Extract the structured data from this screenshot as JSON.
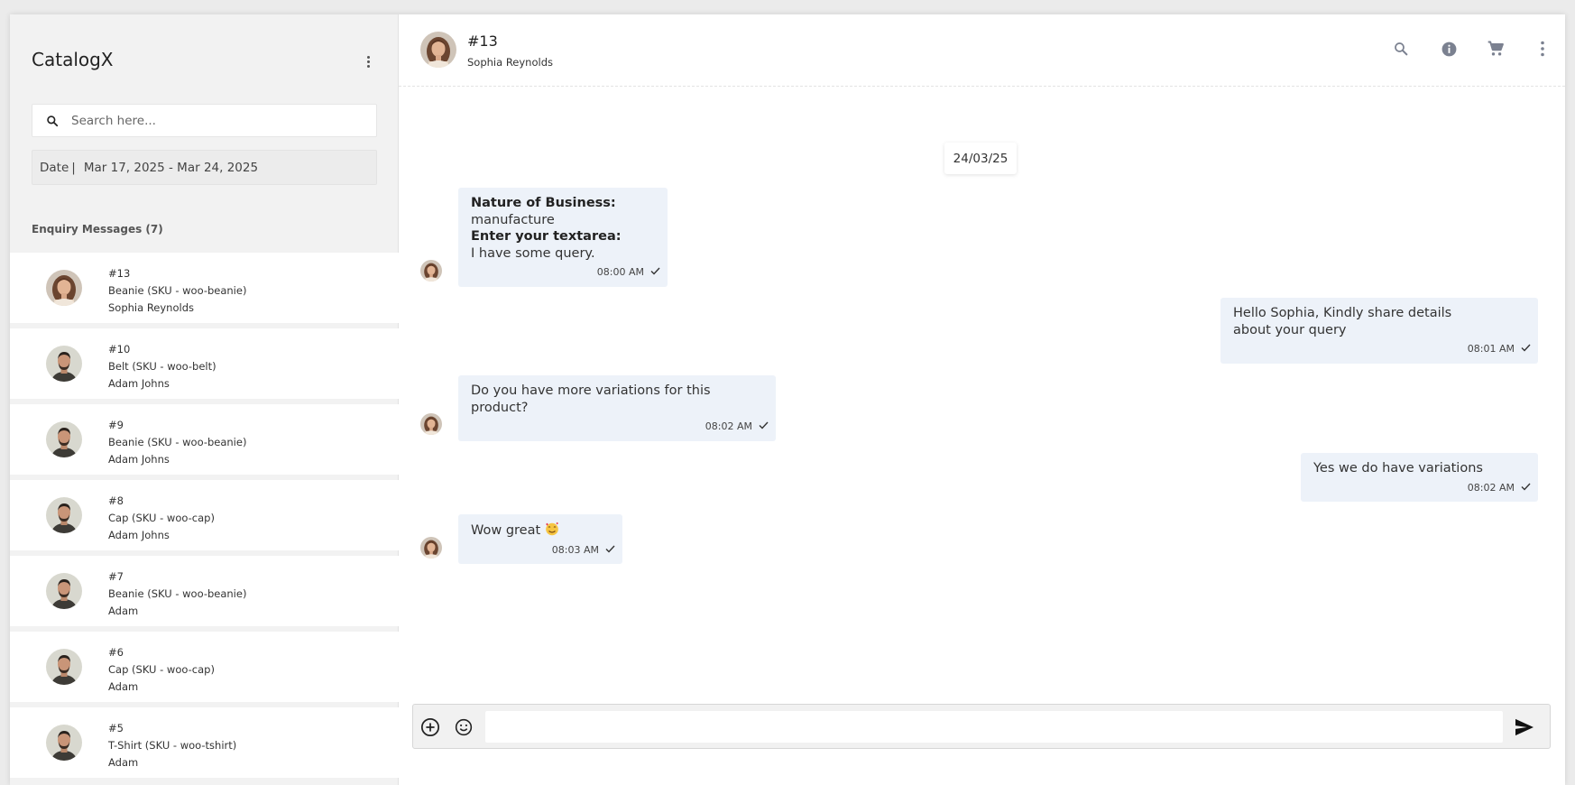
{
  "sidebar": {
    "brand": "CatalogX",
    "search_placeholder": "Search here...",
    "date_label": "Date",
    "date_separator": "|",
    "date_range": "Mar 17, 2025 - Mar 24, 2025",
    "section_title": "Enquiry Messages (7)",
    "items": [
      {
        "id": "#13",
        "product": "Beanie (SKU - woo-beanie)",
        "name": "Sophia Reynolds",
        "avatar": "female"
      },
      {
        "id": "#10",
        "product": "Belt (SKU - woo-belt)",
        "name": "Adam Johns",
        "avatar": "male"
      },
      {
        "id": "#9",
        "product": "Beanie (SKU - woo-beanie)",
        "name": "Adam Johns",
        "avatar": "male"
      },
      {
        "id": "#8",
        "product": "Cap (SKU - woo-cap)",
        "name": "Adam Johns",
        "avatar": "male"
      },
      {
        "id": "#7",
        "product": "Beanie (SKU - woo-beanie)",
        "name": "Adam",
        "avatar": "male"
      },
      {
        "id": "#6",
        "product": "Cap (SKU - woo-cap)",
        "name": "Adam",
        "avatar": "male"
      },
      {
        "id": "#5",
        "product": "T-Shirt (SKU - woo-tshirt)",
        "name": "Adam",
        "avatar": "male"
      }
    ]
  },
  "header": {
    "title": "#13",
    "subtitle": "Sophia Reynolds",
    "icons": [
      "search-icon",
      "info-icon",
      "cart-icon",
      "more-vert-icon"
    ]
  },
  "chat": {
    "date_chip": "24/03/25",
    "messages": [
      {
        "side": "left",
        "label1": "Nature of Business:",
        "value1": "manufacture",
        "label2": "Enter your textarea:",
        "value2": "I have some query.",
        "time": "08:00 AM"
      },
      {
        "side": "right",
        "line1": "Hello Sophia, Kindly share details",
        "line2": "about your query",
        "time": "08:01 AM"
      },
      {
        "side": "left",
        "line1": "Do you have more variations for this",
        "line2": "product?",
        "time": "08:02 AM"
      },
      {
        "side": "right",
        "text": "Yes we do have variations",
        "time": "08:02 AM"
      },
      {
        "side": "left",
        "text": "Wow great",
        "emoji": "smiling-face-with-hearts",
        "time": "08:03 AM"
      }
    ]
  },
  "composer": {
    "value": "",
    "icons": [
      "add-circle-icon",
      "emoji-icon",
      "send-icon"
    ]
  },
  "colors": {
    "bubble": "#edf2f9",
    "sidebar_bg": "#f2f2f2",
    "page_bg": "#ebebeb",
    "icon_gray": "#7b8190"
  }
}
